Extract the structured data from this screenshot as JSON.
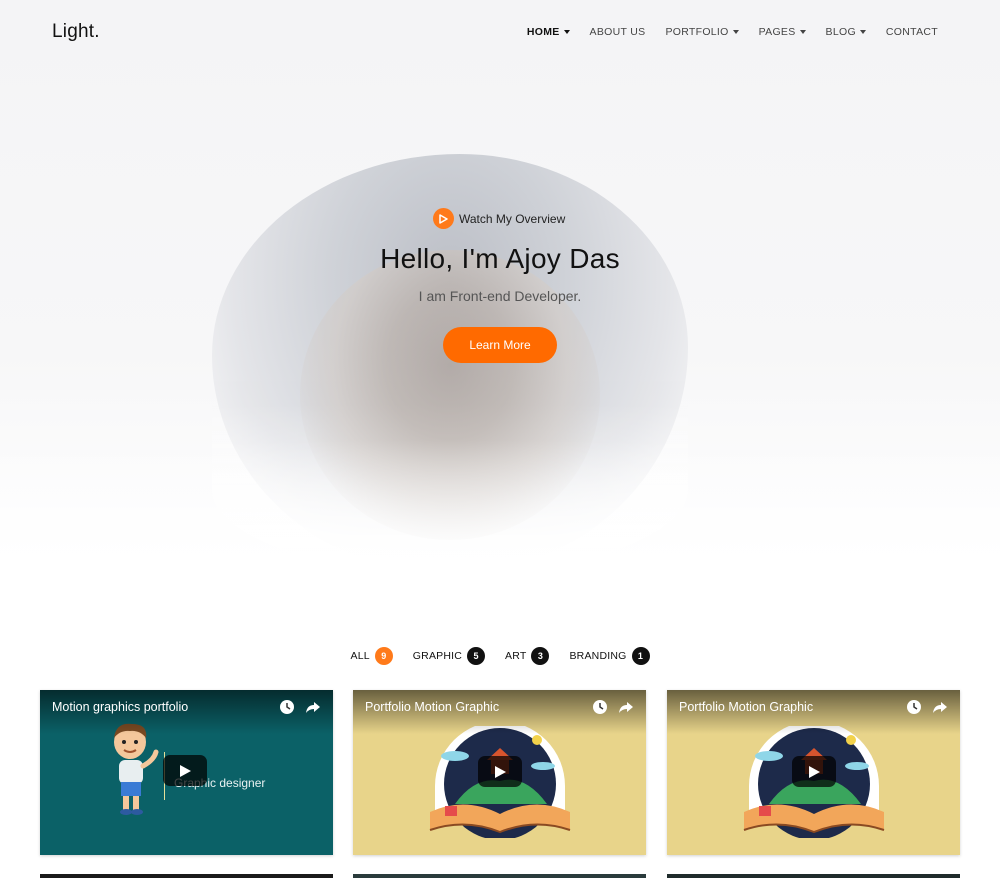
{
  "brand": {
    "logo": "Light."
  },
  "nav": {
    "items": [
      {
        "label": "HOME",
        "dropdown": true,
        "active": true
      },
      {
        "label": "ABOUT US",
        "dropdown": false,
        "active": false
      },
      {
        "label": "PORTFOLIO",
        "dropdown": true,
        "active": false
      },
      {
        "label": "PAGES",
        "dropdown": true,
        "active": false
      },
      {
        "label": "BLOG",
        "dropdown": true,
        "active": false
      },
      {
        "label": "CONTACT",
        "dropdown": false,
        "active": false
      }
    ]
  },
  "hero": {
    "watch_label": "Watch My Overview",
    "title": "Hello, I'm Ajoy Das",
    "subtitle": "I am Front-end Developer.",
    "cta_label": "Learn More"
  },
  "filters": [
    {
      "label": "ALL",
      "count": "9",
      "active": true
    },
    {
      "label": "GRAPHIC",
      "count": "5",
      "active": false
    },
    {
      "label": "ART",
      "count": "3",
      "active": false
    },
    {
      "label": "BRANDING",
      "count": "1",
      "active": false
    }
  ],
  "cards": [
    {
      "title": "Motion graphics portfolio",
      "caption": "Graphic designer"
    },
    {
      "title": "Portfolio Motion Graphic",
      "caption": ""
    },
    {
      "title": "Portfolio Motion Graphic",
      "caption": ""
    }
  ],
  "colors": {
    "accent": "#ff6a00",
    "badge_dark": "#111111",
    "card_teal": "#0b6167",
    "card_sand": "#e8d48a"
  },
  "icons": {
    "watch": "play-icon",
    "card_clock": "clock-icon",
    "card_share": "share-icon",
    "card_play": "play-icon"
  }
}
